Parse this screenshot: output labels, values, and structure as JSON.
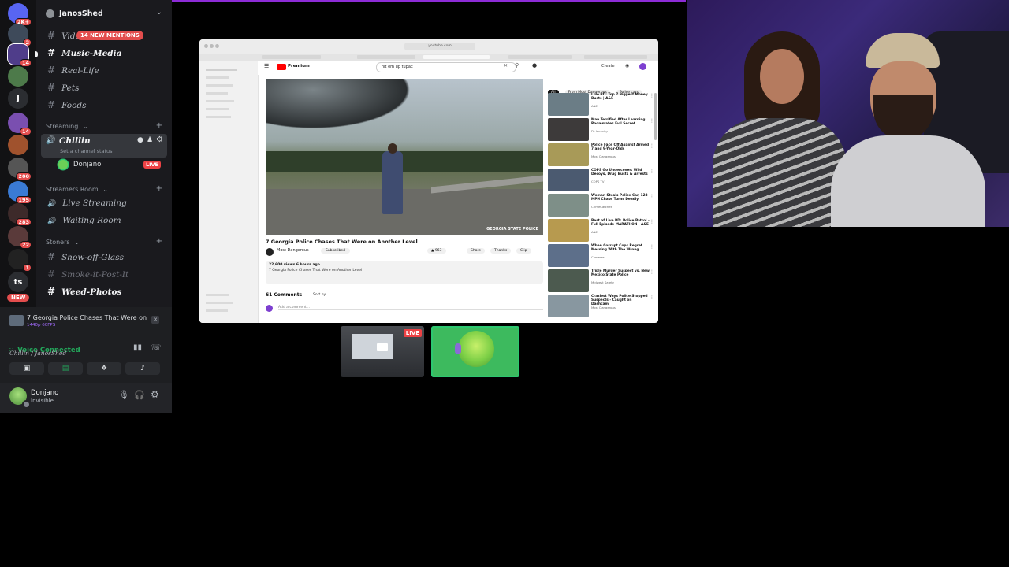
{
  "server_rail": {
    "badges": [
      "2K+",
      "2",
      "14",
      "14",
      "200",
      "195",
      "283",
      "22",
      "1"
    ],
    "letter_server": "J",
    "ts_server": "ts",
    "new_pill": "NEW"
  },
  "server": {
    "name": "JanosShed",
    "mentions_pill": "14 NEW MENTIONS"
  },
  "channels": {
    "top": [
      {
        "label": "Vide"
      },
      {
        "label": "Music-Media"
      },
      {
        "label": "Real-Life"
      },
      {
        "label": "Pets"
      },
      {
        "label": "Foods"
      }
    ],
    "streaming": {
      "category": "Streaming",
      "voice_channel": "Chillin",
      "status_hint": "Set a channel status",
      "member": "Donjano",
      "live": "LIVE"
    },
    "streamers_room": {
      "category": "Streamers Room",
      "items": [
        "Live Streaming",
        "Waiting Room"
      ]
    },
    "stoners": {
      "category": "Stoners",
      "items": [
        "Show-off-Glass",
        "Smoke-it-Post-It",
        "Weed-Photos"
      ]
    }
  },
  "activity": {
    "title": "7 Georgia Police Chases That Were on An...",
    "sub": "1440p 60FPS"
  },
  "voice": {
    "status": "Voice Connected",
    "location": "Chillin / JanosShed"
  },
  "user": {
    "name": "Donjano",
    "status": "Invisible"
  },
  "youtube": {
    "url": "youtube.com",
    "search": "hit em up tupac",
    "logo": "Premium",
    "create": "Create",
    "video_title": "7 Georgia Police Chases That Were on Another Level",
    "watermark": "GEORGIA STATE POLICE",
    "channel": "Most Dangerous",
    "subscribe": "Subscribed",
    "likes": "963",
    "share": "Share",
    "thanks": "Thanks",
    "clip": "Clip",
    "views": "22,600 views 6 hours ago",
    "desc": "7 Georgia Police Chases That Were on Another Level",
    "comments": "61 Comments",
    "sort": "Sort by",
    "add_comment": "Add a comment...",
    "chips": [
      "All",
      "From Most Dangerous",
      "Police cars"
    ],
    "sidebar": [
      {
        "title": "Live PD: Top 7 Biggest Money Busts | A&E",
        "channel": "A&E",
        "thumb": "#6b7d86"
      },
      {
        "title": "Man Terrified After Learning Roommates Evil Secret",
        "channel": "Dr Insanity",
        "thumb": "#3d3a3a"
      },
      {
        "title": "Police Face Off Against Armed 7 and 9-Year-Olds",
        "channel": "Most Dangerous",
        "thumb": "#a89a58"
      },
      {
        "title": "COPS Go Undercover: Wild Decoys, Drug Busts & Arrests",
        "channel": "COPS TV",
        "thumb": "#4b5a70"
      },
      {
        "title": "Woman Steals Police Car, 123 MPH Chase Turns Deadly",
        "channel": "CrimeCatches",
        "thumb": "#7e8f88"
      },
      {
        "title": "Best of Live PD: Police Patrol - Full Episode MARATHON | A&E",
        "channel": "A&E",
        "thumb": "#b79a4f"
      },
      {
        "title": "When Corrupt Cops Regret Messing With The Wrong",
        "channel": "Cameras",
        "thumb": "#5d6f8a"
      },
      {
        "title": "Triple Murder Suspect vs. New Mexico State Police",
        "channel": "Midwest Safety",
        "thumb": "#4c5a4f"
      },
      {
        "title": "Craziest Ways Police Stopped Suspects - Caught on Dashcam",
        "channel": "Most Dangerous",
        "thumb": "#8897a0"
      }
    ]
  },
  "tiles": {
    "live": "LIVE"
  },
  "colors": {
    "accent": "#5865f2",
    "live_red": "#ed4245",
    "voice_green": "#23a55a",
    "speaking_green": "#2dc770",
    "top_bar_purple": "#8c2bd6"
  }
}
